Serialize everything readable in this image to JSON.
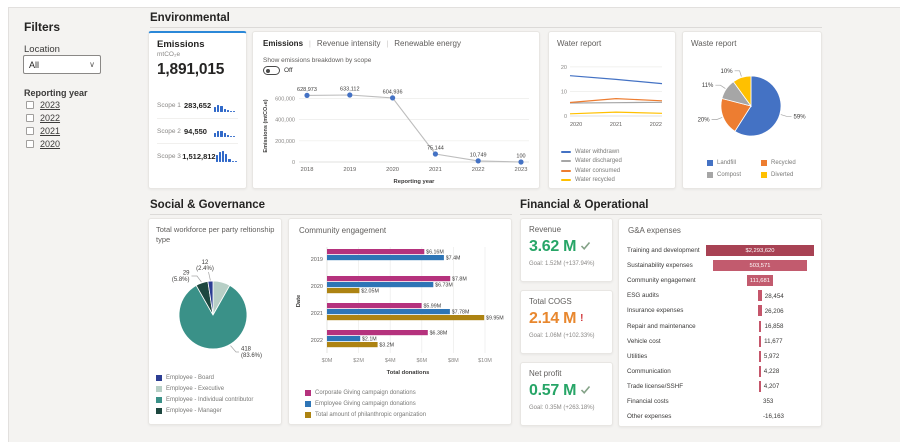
{
  "filters": {
    "title": "Filters",
    "location_label": "Location",
    "location_value": "All",
    "reporting_year_label": "Reporting year",
    "years": [
      "2023",
      "2022",
      "2021",
      "2020"
    ]
  },
  "sections": {
    "environmental": "Environmental",
    "social": "Social & Governance",
    "financial": "Financial & Operational"
  },
  "emissions_kpi": {
    "title": "Emissions",
    "unit": "mtCO₂e",
    "total": "1,891,015",
    "scopes": [
      {
        "label": "Scope 1",
        "value": "283,652",
        "spark": [
          5,
          7,
          6,
          3,
          2,
          1,
          1
        ]
      },
      {
        "label": "Scope 2",
        "value": "94,550",
        "spark": [
          4,
          6,
          6,
          4,
          2,
          1,
          1
        ]
      },
      {
        "label": "Scope 3",
        "value": "1,512,812",
        "spark": [
          7,
          10,
          11,
          8,
          3,
          1,
          1
        ]
      }
    ]
  },
  "emissions_panel": {
    "tabs": [
      {
        "label": "Emissions",
        "active": true
      },
      {
        "label": "Revenue intensity",
        "active": false
      },
      {
        "label": "Renewable energy",
        "active": false
      }
    ],
    "toggle_label": "Show emissions breakdown by scope",
    "toggle_state": "Off"
  },
  "kpis": [
    {
      "title": "Revenue",
      "value": "3.62 M",
      "icon": "check",
      "status": "good",
      "goal": "Goal: 1.52M (+137.94%)"
    },
    {
      "title": "Total COGS",
      "value": "2.14 M",
      "icon": "exclaim",
      "status": "warn",
      "goal": "Goal: 1.06M (+102.33%)"
    },
    {
      "title": "Net profit",
      "value": "0.57 M",
      "icon": "check",
      "status": "good",
      "goal": "Goal: 0.35M (+263.18%)"
    }
  ],
  "colors": {
    "accent_blue": "#2b88d8",
    "chart_blue": "#4472c4",
    "orange": "#ed7d31",
    "gray": "#a6a6a6",
    "yellow": "#ffc000",
    "kpi_green": "#27a567",
    "kpi_orange": "#e8872e",
    "check_green": "#84a287",
    "alert_red": "#d13438",
    "magenta": "#b5327d",
    "steel_blue": "#2e75b6",
    "gold": "#ad8312",
    "rose_dark": "#a84254",
    "rose_mid": "#c25b6e",
    "rose": "#c5566b",
    "spark_blue": "#3069c9"
  },
  "chart_data": [
    {
      "id": "emissions-trend",
      "type": "line",
      "xlabel": "Reporting year",
      "ylabel": "Emissions (mtCO₂e)",
      "x": [
        "2018",
        "2019",
        "2020",
        "2021",
        "2022",
        "2023"
      ],
      "values": [
        628973,
        633112,
        604936,
        75144,
        10749,
        100
      ],
      "point_labels": [
        "628,973",
        "633,112",
        "604,936",
        "75,144",
        "10,749",
        "100"
      ],
      "yticks": [
        0,
        200000,
        400000,
        600000
      ],
      "ytick_labels": [
        "0",
        "200,000",
        "400,000",
        "600,000"
      ],
      "ylim": [
        0,
        680000
      ],
      "line_color": "#bdbdbd",
      "point_color": "#4472c4"
    },
    {
      "id": "water-report",
      "type": "line",
      "title": "Water report",
      "x": [
        "2020",
        "2021",
        "2022"
      ],
      "yticks": [
        0,
        10,
        20
      ],
      "ylim": [
        0,
        22
      ],
      "series": [
        {
          "name": "Water withdrawn",
          "color": "#4472c4",
          "values": [
            16.4,
            14.9,
            13.2
          ]
        },
        {
          "name": "Water discharged",
          "color": "#a6a6a6",
          "values": [
            5.3,
            5.4,
            5.6
          ]
        },
        {
          "name": "Water consumed",
          "color": "#ed7d31",
          "values": [
            5.5,
            7.1,
            6.2
          ]
        },
        {
          "name": "Water recycled",
          "color": "#ffc000",
          "values": [
            0.9,
            1.6,
            1.1
          ]
        }
      ]
    },
    {
      "id": "waste-report",
      "type": "pie",
      "title": "Waste report",
      "slices": [
        {
          "name": "Landfill",
          "pct": 59,
          "label": "59%",
          "color": "#4472c4"
        },
        {
          "name": "Recycled",
          "pct": 20,
          "label": "20%",
          "color": "#ed7d31"
        },
        {
          "name": "Compost",
          "pct": 11,
          "label": "11%",
          "color": "#a6a6a6"
        },
        {
          "name": "Diverted",
          "pct": 10,
          "label": "10%",
          "color": "#ffc000"
        }
      ]
    },
    {
      "id": "workforce",
      "type": "pie",
      "title": "Total workforce per party reltionship type",
      "slices": [
        {
          "name": "Employee - Board",
          "value": 12,
          "pct": 2.4,
          "label": "12",
          "pct_label": "(2.4%)",
          "color": "#2c3e93"
        },
        {
          "name": "Employee - Executive",
          "value": 41,
          "pct": 8.2,
          "label": "",
          "pct_label": "",
          "color": "#b7cfc6"
        },
        {
          "name": "Employee - Individual contributor",
          "value": 418,
          "pct": 83.6,
          "label": "418",
          "pct_label": "(83.6%)",
          "color": "#3a9188"
        },
        {
          "name": "Employee - Manager",
          "value": 29,
          "pct": 5.8,
          "label": "29",
          "pct_label": "(5.8%)",
          "color": "#1d473f"
        }
      ]
    },
    {
      "id": "community-engagement",
      "type": "bar",
      "orientation": "horizontal",
      "title": "Community engagement",
      "xlabel": "Total donations",
      "ylabel": "Date",
      "categories": [
        "2019",
        "2020",
        "2021",
        "2022"
      ],
      "xticks": [
        "$0M",
        "$2M",
        "$4M",
        "$6M",
        "$8M",
        "$10M"
      ],
      "xlim": [
        0,
        10
      ],
      "series": [
        {
          "name": "Corporate Giving campaign donations",
          "color": "#b5327d",
          "values": [
            6.16,
            7.8,
            5.99,
            6.38
          ],
          "labels": [
            "$6.16M",
            "$7.8M",
            "$5.99M",
            "$6.38M"
          ]
        },
        {
          "name": "Employee Giving campaign donations",
          "color": "#2e75b6",
          "values": [
            7.4,
            6.73,
            7.78,
            2.1
          ],
          "labels": [
            "$7.4M",
            "$6.73M",
            "$7.78M",
            "$2.1M"
          ]
        },
        {
          "name": "Total amount of philanthropic organization",
          "color": "#ad8312",
          "values": [
            0,
            2.05,
            9.95,
            3.2
          ],
          "labels": [
            "",
            "$2.05M",
            "$9.95M",
            "$3.2M"
          ]
        }
      ]
    },
    {
      "id": "gna-expenses",
      "type": "bar",
      "title": "G&A expenses",
      "rows": [
        {
          "label": "Training and development",
          "value": "$2,293,620",
          "bar_pct": 100,
          "inside": true
        },
        {
          "label": "Sustainability expenses",
          "value": "503,571",
          "bar_pct": 87,
          "inside": true
        },
        {
          "label": "Community engagement",
          "value": "111,681",
          "bar_pct": 24,
          "inside": true
        },
        {
          "label": "ESG audits",
          "value": "28,454",
          "bar_pct": 3.4,
          "inside": false
        },
        {
          "label": "Insurance expenses",
          "value": "26,206",
          "bar_pct": 3.1,
          "inside": false
        },
        {
          "label": "Repair and maintenance",
          "value": "16,858",
          "bar_pct": 2.7,
          "inside": false
        },
        {
          "label": "Vehicle cost",
          "value": "11,677",
          "bar_pct": 2.1,
          "inside": false
        },
        {
          "label": "Utilities",
          "value": "5,972",
          "bar_pct": 1.6,
          "inside": false
        },
        {
          "label": "Communication",
          "value": "4,228",
          "bar_pct": 1.3,
          "inside": false
        },
        {
          "label": "Trade license/SSHF",
          "value": "4,207",
          "bar_pct": 1.3,
          "inside": false
        },
        {
          "label": "Financial costs",
          "value": "353",
          "bar_pct": 0,
          "inside": false
        },
        {
          "label": "Other expenses",
          "value": "-16,163",
          "bar_pct": 0,
          "inside": false
        }
      ]
    }
  ]
}
